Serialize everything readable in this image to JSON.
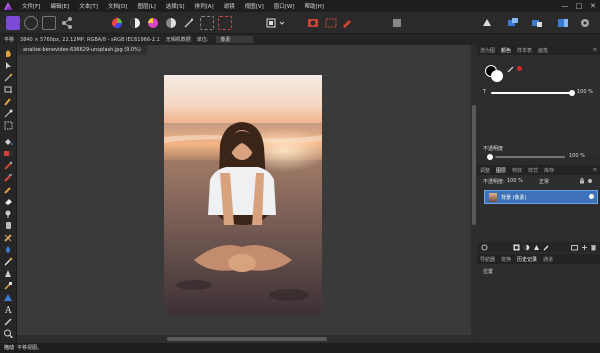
{
  "menubar": {
    "items": [
      "文件[F]",
      "编辑[E]",
      "文本[T]",
      "文档[D]",
      "图层[L]",
      "选择[S]",
      "排列[A]",
      "滤镜",
      "视图[V]",
      "窗口[W]",
      "帮助[H]"
    ],
    "window_controls": [
      "—",
      "□",
      "✕"
    ]
  },
  "context_bar": {
    "tool": "平移",
    "image_info": "3840 × 5760px, 22.12MP, RGBA/8 - sRGB IEC61966-2.1",
    "profile": "无相机数据",
    "unit_label": "单位:",
    "unit_value": "像素"
  },
  "document": {
    "tab_title": "analise-benevides-636629-unsplash.jpg (9.0%)"
  },
  "color_panel": {
    "tabs": [
      "流为图",
      "颜色",
      "样本表",
      "画笔"
    ],
    "active_tab": "颜色",
    "opacity_label": "T",
    "opacity_value": "100 %",
    "noise_label": "不透明度",
    "noise_value": "100 %",
    "accent_color": "#d6242d"
  },
  "layers_panel": {
    "tabs": [
      "调整",
      "图层",
      "特效",
      "样式",
      "库存"
    ],
    "active_tab": "图层",
    "opacity_label": "不透明度:",
    "opacity_value": "100 %",
    "blend_mode": "正常",
    "layer_name": "背景 (像素)",
    "selected_color": "#3d72b8"
  },
  "history_panel": {
    "tabs": [
      "导航器",
      "变换",
      "历史记录",
      "通道"
    ],
    "active_tab": "历史记录",
    "entry": "位置"
  },
  "statusbar": {
    "bold": "拖动",
    "text": "平移视图。"
  }
}
